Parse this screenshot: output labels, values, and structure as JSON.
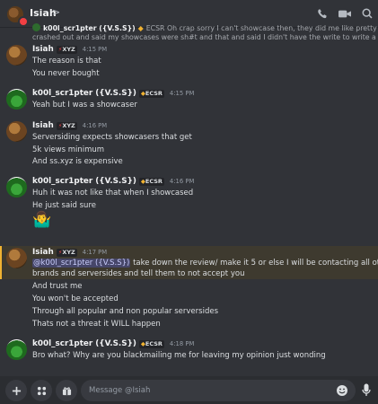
{
  "header": {
    "name": "Isiah",
    "chevron": ">"
  },
  "reply": {
    "name": "k00l_scr1pter ({V.S.S})",
    "tag": "ECSR",
    "line1": "Oh crap sorry I can't showcase then, they did me like pretty bad. He kinda",
    "line2": "crashed out and said my showcases were sh#t and that and said I didn't have the write to write a review for the..."
  },
  "messages": [
    {
      "id": "m1",
      "user": "Isiah",
      "tag": "XYZ",
      "time": "4:15 PM",
      "lines": [
        "The reason is that",
        "You never bought"
      ]
    },
    {
      "id": "m2",
      "user": "k00l_scr1pter ({V.S.S})",
      "tag": "ECSR",
      "time": "4:15 PM",
      "lines": [
        "Yeah but I was a showcaser"
      ]
    },
    {
      "id": "m3",
      "user": "Isiah",
      "tag": "XYZ",
      "time": "4:16 PM",
      "lines": [
        "Serversiding expects showcasers that get",
        "5k views minimum",
        "And ss.xyz is expensive"
      ]
    },
    {
      "id": "m4",
      "user": "k00l_scr1pter ({V.S.S})",
      "tag": "ECSR",
      "time": "4:16 PM",
      "lines": [
        "Huh it was not like that when I showcased",
        "He just said sure"
      ]
    },
    {
      "id": "m5",
      "user": "Isiah",
      "tag": "XYZ",
      "time": "4:17 PM",
      "mention": "@k00l_scr1pter ({V.S.S})",
      "mention_rest": " take down the review/ make it 5 or else I will be contacting all other",
      "mention_line2": "brands and serversides and tell them to not accept you",
      "lines": [
        "And trust me",
        "You won't be accepted",
        "Through all popular and non popular serversides",
        "Thats not a threat it WILL happen"
      ]
    },
    {
      "id": "m6",
      "user": "k00l_scr1pter ({V.S.S})",
      "tag": "ECSR",
      "time": "4:18 PM",
      "lines": [
        "Bro what? Why are you blackmailing me for leaving my opinion just wonding"
      ]
    }
  ],
  "emoji": "🤷‍♂️",
  "input": {
    "placeholder": "Message @Isiah"
  },
  "colors": {
    "background": "#313338",
    "input_bar": "#2b2d31",
    "mention_highlight": "#f0b232",
    "tag_xyz": "#f23f43",
    "tag_ecsr": "#f0b232"
  }
}
